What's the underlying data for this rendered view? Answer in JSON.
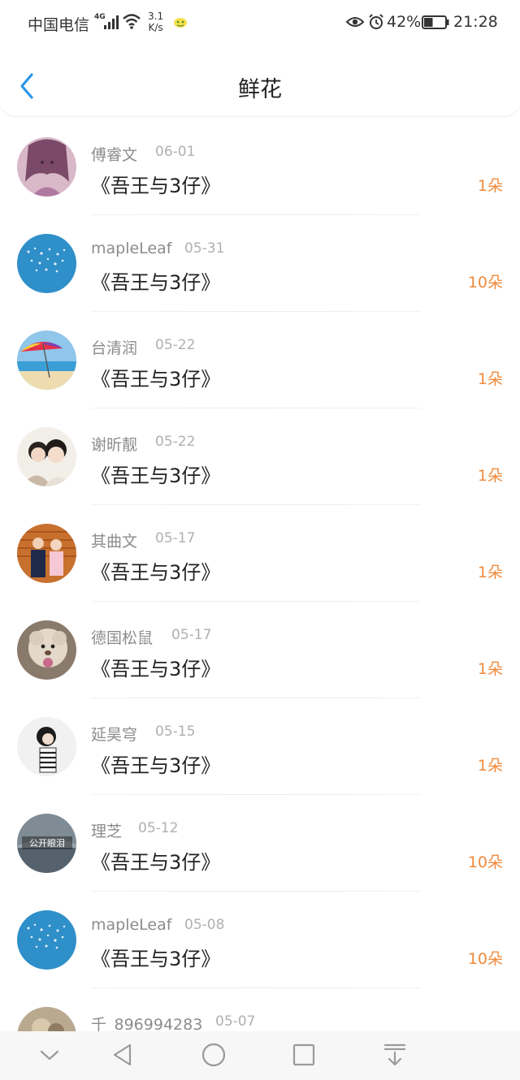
{
  "status_bar": {
    "carrier": "中国电信",
    "network": "4G",
    "speed_value": "3.1",
    "speed_unit": "K/s",
    "battery_percent": "42%",
    "battery_level": 0.42,
    "time": "21:28"
  },
  "nav": {
    "title": "鲜花",
    "back_icon": "chevron-left-icon"
  },
  "colors": {
    "accent": "#2a96e6",
    "count": "#f08a3c"
  },
  "flowers": [
    {
      "user": "傅睿文",
      "date": "06-01",
      "book": "《吾王与3仔》",
      "count": "1朵"
    },
    {
      "user": "mapleLeaf",
      "date": "05-31",
      "book": "《吾王与3仔》",
      "count": "10朵"
    },
    {
      "user": "台清润",
      "date": "05-22",
      "book": "《吾王与3仔》",
      "count": "1朵"
    },
    {
      "user": "谢昕靓",
      "date": "05-22",
      "book": "《吾王与3仔》",
      "count": "1朵"
    },
    {
      "user": "其曲文",
      "date": "05-17",
      "book": "《吾王与3仔》",
      "count": "1朵"
    },
    {
      "user": "德国松鼠",
      "date": "05-17",
      "book": "《吾王与3仔》",
      "count": "1朵"
    },
    {
      "user": "延昊穹",
      "date": "05-15",
      "book": "《吾王与3仔》",
      "count": "1朵"
    },
    {
      "user": "理芝",
      "date": "05-12",
      "book": "《吾王与3仔》",
      "count": "10朵"
    },
    {
      "user": "mapleLeaf",
      "date": "05-08",
      "book": "《吾王与3仔》",
      "count": "10朵"
    },
    {
      "user": "千_896994283",
      "date": "05-07",
      "book": "",
      "count": ""
    }
  ],
  "avatar_9_text": "公开眼泪",
  "system_nav": [
    "hide-keyboard-icon",
    "back-triangle-icon",
    "home-circle-icon",
    "recents-square-icon",
    "notification-pull-icon"
  ]
}
